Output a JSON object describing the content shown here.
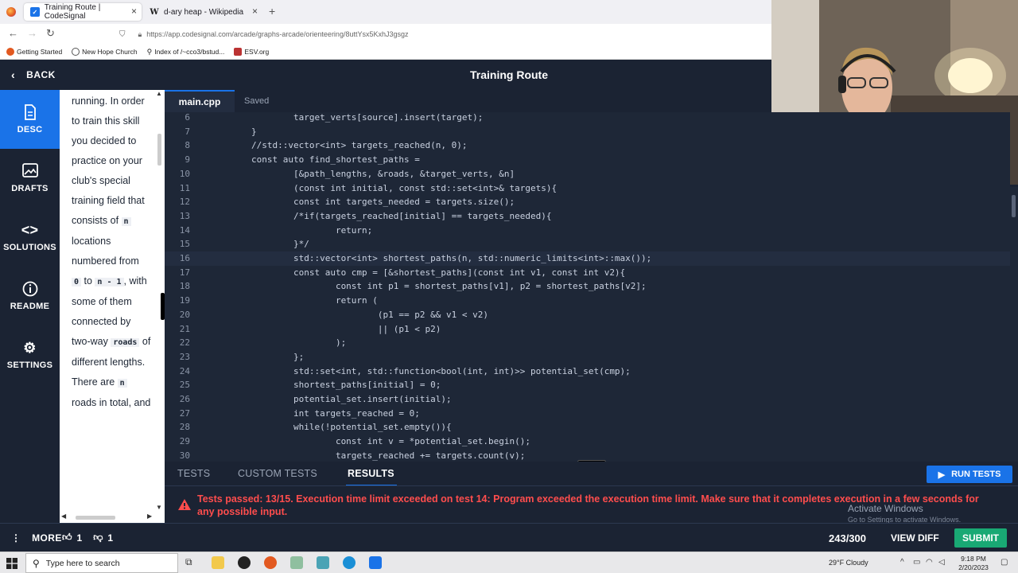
{
  "browser": {
    "tabs": [
      {
        "title": "Training Route | CodeSignal",
        "active": true
      },
      {
        "title": "d-ary heap - Wikipedia",
        "active": false
      }
    ],
    "url": "https://app.codesignal.com/arcade/graphs-arcade/orienteering/8uttYsx5KxhJ3gsgz",
    "bookmarks": [
      "Getting Started",
      "New Hope Church",
      "Index of /~cco3/bstud...",
      "ESV.org"
    ]
  },
  "header": {
    "back_label": "BACK",
    "title": "Training Route"
  },
  "left_nav": {
    "items": [
      {
        "label": "DESC",
        "icon": "document-icon",
        "active": true
      },
      {
        "label": "DRAFTS",
        "icon": "image-edit-icon",
        "active": false
      },
      {
        "label": "SOLUTIONS",
        "icon": "code-brackets-icon",
        "active": false
      },
      {
        "label": "README",
        "icon": "info-icon",
        "active": false
      },
      {
        "label": "SETTINGS",
        "icon": "gear-icon",
        "active": false
      }
    ]
  },
  "description": {
    "segments": [
      {
        "t": "running. In order to train this skill you decided to practice on your club's special training field that consists of "
      },
      {
        "c": "n"
      },
      {
        "t": " locations numbered from "
      },
      {
        "c": "0"
      },
      {
        "t": " to "
      },
      {
        "c": "n - 1"
      },
      {
        "t": ", with some of them connected by two-way "
      },
      {
        "c": "roads"
      },
      {
        "t": " of different lengths. There are "
      },
      {
        "c": "n"
      },
      {
        "t": " roads in total, and"
      }
    ]
  },
  "editor": {
    "file_name": "main.cpp",
    "status": "Saved",
    "current_line": 16,
    "lines": [
      {
        "n": "6",
        "code": "                target_verts[source].insert(target);"
      },
      {
        "n": "7",
        "code": "        }"
      },
      {
        "n": "8",
        "code": "        //std::vector<int> targets_reached(n, 0);"
      },
      {
        "n": "9",
        "code": "        const auto find_shortest_paths ="
      },
      {
        "n": "10",
        "code": "                [&path_lengths, &roads, &target_verts, &n]"
      },
      {
        "n": "11",
        "code": "                (const int initial, const std::set<int>& targets){"
      },
      {
        "n": "12",
        "code": "                const int targets_needed = targets.size();"
      },
      {
        "n": "13",
        "code": "                /*if(targets_reached[initial] == targets_needed){"
      },
      {
        "n": "14",
        "code": "                        return;"
      },
      {
        "n": "15",
        "code": "                }*/"
      },
      {
        "n": "16",
        "code": "                std::vector<int> shortest_paths(n, std::numeric_limits<int>::max());"
      },
      {
        "n": "17",
        "code": "                const auto cmp = [&shortest_paths](const int v1, const int v2){"
      },
      {
        "n": "18",
        "code": "                        const int p1 = shortest_paths[v1], p2 = shortest_paths[v2];"
      },
      {
        "n": "19",
        "code": "                        return ("
      },
      {
        "n": "20",
        "code": "                                (p1 == p2 && v1 < v2)"
      },
      {
        "n": "21",
        "code": "                                || (p1 < p2)"
      },
      {
        "n": "22",
        "code": "                        );"
      },
      {
        "n": "23",
        "code": "                };"
      },
      {
        "n": "24",
        "code": "                std::set<int, std::function<bool(int, int)>> potential_set(cmp);"
      },
      {
        "n": "25",
        "code": "                shortest_paths[initial] = 0;"
      },
      {
        "n": "26",
        "code": "                potential_set.insert(initial);"
      },
      {
        "n": "27",
        "code": "                int targets_reached = 0;"
      },
      {
        "n": "28",
        "code": "                while(!potential_set.empty()){"
      },
      {
        "n": "29",
        "code": "                        const int v = *potential_set.begin();"
      },
      {
        "n": "30",
        "code": "                        targets_reached += targets.count(v);"
      }
    ]
  },
  "results": {
    "tabs": [
      "TESTS",
      "CUSTOM TESTS",
      "RESULTS"
    ],
    "active_tab": "RESULTS",
    "run_label": "RUN TESTS",
    "message": "Tests passed: 13/15. Execution time limit exceeded on test 14: Program exceeded the execution time limit. Make sure that it completes execution in a few seconds for any possible input.",
    "watermark_title": "Activate Windows",
    "watermark_sub": "Go to Settings to activate Windows."
  },
  "footer": {
    "more_label": "MORE",
    "upvotes": "1",
    "downvotes": "1",
    "score": "243/300",
    "view_diff_label": "VIEW DIFF",
    "submit_label": "SUBMIT"
  },
  "taskbar": {
    "search_placeholder": "Type here to search",
    "weather": "29°F  Cloudy",
    "time": "9:18 PM",
    "date": "2/20/2023"
  },
  "colors": {
    "accent": "#1a73e8",
    "error": "#ff4d4d",
    "submit": "#19a974",
    "background": "#1b2333"
  }
}
